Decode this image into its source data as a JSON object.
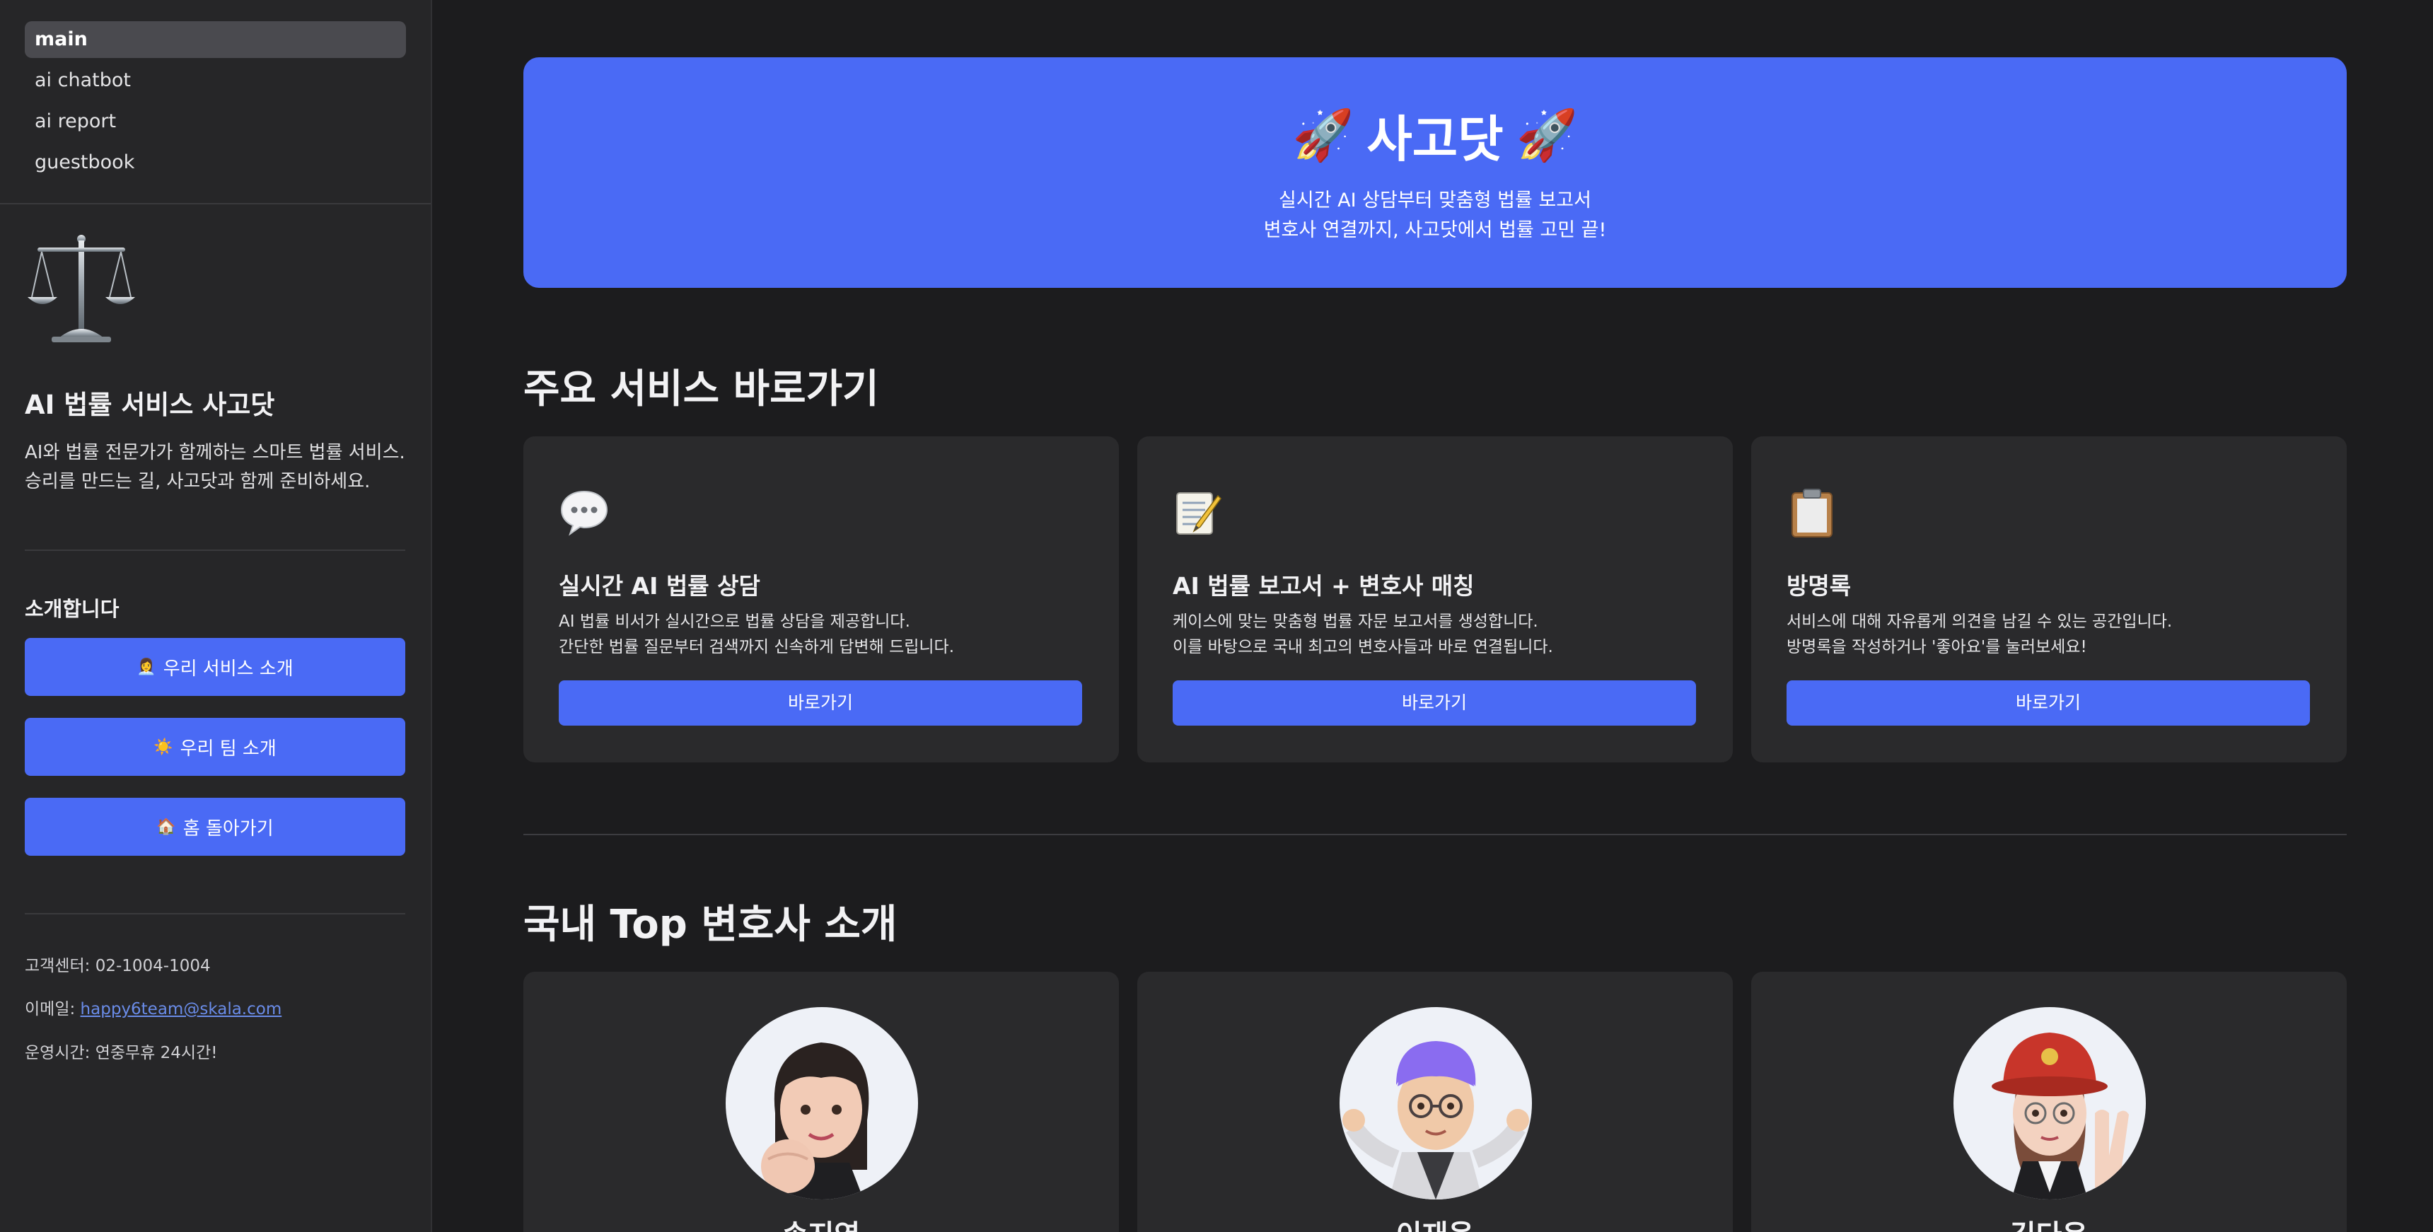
{
  "sidebar": {
    "nav": [
      "main",
      "ai chatbot",
      "ai report",
      "guestbook"
    ],
    "logo_icon": "scales-of-justice-icon",
    "title": "AI 법률 서비스 사고닷",
    "desc_line1": "AI와 법률 전문가가 함께하는 스마트 법률 서비스.",
    "desc_line2": "승리를 만드는 길, 사고닷과 함께 준비하세요.",
    "intro_heading": "소개합니다",
    "buttons": [
      {
        "icon": "👩‍💼",
        "label": "우리 서비스 소개"
      },
      {
        "icon": "☀️",
        "label": "우리 팀 소개"
      },
      {
        "icon": "🏠",
        "label": "홈 돌아가기"
      }
    ],
    "contact": {
      "phone": "고객센터: 02-1004-1004",
      "email_label": "이메일: ",
      "email": "happy6team@skala.com",
      "hours": "운영시간: 연중무휴 24시간!"
    }
  },
  "hero": {
    "rocket": "🚀",
    "title": "사고닷",
    "line1": "실시간 AI 상담부터 맞춤형 법률 보고서",
    "line2": "변호사 연결까지, 사고닷에서 법률 고민 끝!"
  },
  "services": {
    "heading": "주요 서비스 바로가기",
    "cards": [
      {
        "icon": "speech-bubble-icon",
        "title": "실시간 AI 법률 상담",
        "line1": "AI 법률 비서가 실시간으로 법률 상담을 제공합니다.",
        "line2": "간단한 법률 질문부터 검색까지 신속하게 답변해 드립니다.",
        "button": "바로가기"
      },
      {
        "icon": "memo-icon",
        "title": "AI 법률 보고서 + 변호사 매칭",
        "line1": "케이스에 맞는 맞춤형 법률 자문 보고서를 생성합니다.",
        "line2": "이를 바탕으로 국내 최고의 변호사들과 바로 연결됩니다.",
        "button": "바로가기"
      },
      {
        "icon": "clipboard-icon",
        "title": "방명록",
        "line1": "서비스에 대해 자유롭게 의견을 남길 수 있는 공간입니다.",
        "line2": "방명록을 작성하거나 '좋아요'를 눌러보세요!",
        "button": "바로가기"
      }
    ]
  },
  "lawyers": {
    "heading": "국내 Top 변호사 소개",
    "people": [
      {
        "name": "송지영",
        "avatar": "woman-bangs-fist-avatar"
      },
      {
        "name": "이재웅",
        "avatar": "man-purple-hair-shrug-avatar"
      },
      {
        "name": "김다은",
        "avatar": "woman-firefighter-hat-avatar"
      }
    ]
  },
  "colors": {
    "accent": "#4a6af5",
    "background": "#1c1c1e",
    "sidebar": "#262628",
    "card": "#2a2a2c"
  }
}
